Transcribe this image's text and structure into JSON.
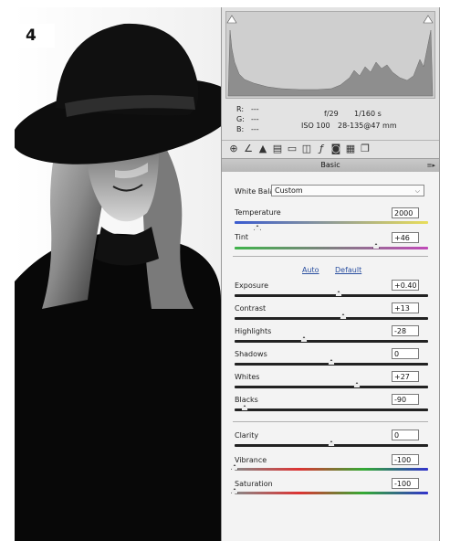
{
  "step_number": "4",
  "info": {
    "r_label": "R:",
    "g_label": "G:",
    "b_label": "B:",
    "r_value": "---",
    "g_value": "---",
    "b_value": "---",
    "aperture": "f/29",
    "shutter": "1/160 s",
    "iso": "ISO 100",
    "lens": "28-135@47 mm"
  },
  "panel": {
    "title": "Basic"
  },
  "white_balance": {
    "label": "White Balance:",
    "selected": "Custom"
  },
  "sliders": {
    "temperature": {
      "label": "Temperature",
      "value": "2000",
      "level": 0.12
    },
    "tint": {
      "label": "Tint",
      "value": "+46",
      "level": 0.73
    },
    "exposure": {
      "label": "Exposure",
      "value": "+0.40",
      "level": 0.54
    },
    "contrast": {
      "label": "Contrast",
      "value": "+13",
      "level": 0.56
    },
    "highlights": {
      "label": "Highlights",
      "value": "-28",
      "level": 0.36
    },
    "shadows": {
      "label": "Shadows",
      "value": "0",
      "level": 0.5
    },
    "whites": {
      "label": "Whites",
      "value": "+27",
      "level": 0.63
    },
    "blacks": {
      "label": "Blacks",
      "value": "-90",
      "level": 0.05
    },
    "clarity": {
      "label": "Clarity",
      "value": "0",
      "level": 0.5
    },
    "vibrance": {
      "label": "Vibrance",
      "value": "-100",
      "level": 0.0
    },
    "saturation": {
      "label": "Saturation",
      "value": "-100",
      "level": 0.0
    }
  },
  "auto_label": "Auto",
  "default_label": "Default",
  "colors": {
    "temperature_track": "linear-gradient(90deg,#3a5bd0,#e8dd5a)",
    "tint_track": "linear-gradient(90deg,#3fb34a,#c04ab8)",
    "gray_track": "linear-gradient(90deg,#222,#222)",
    "vibrance_track": "linear-gradient(90deg,#888,#d33,#3a3,#33c)"
  }
}
